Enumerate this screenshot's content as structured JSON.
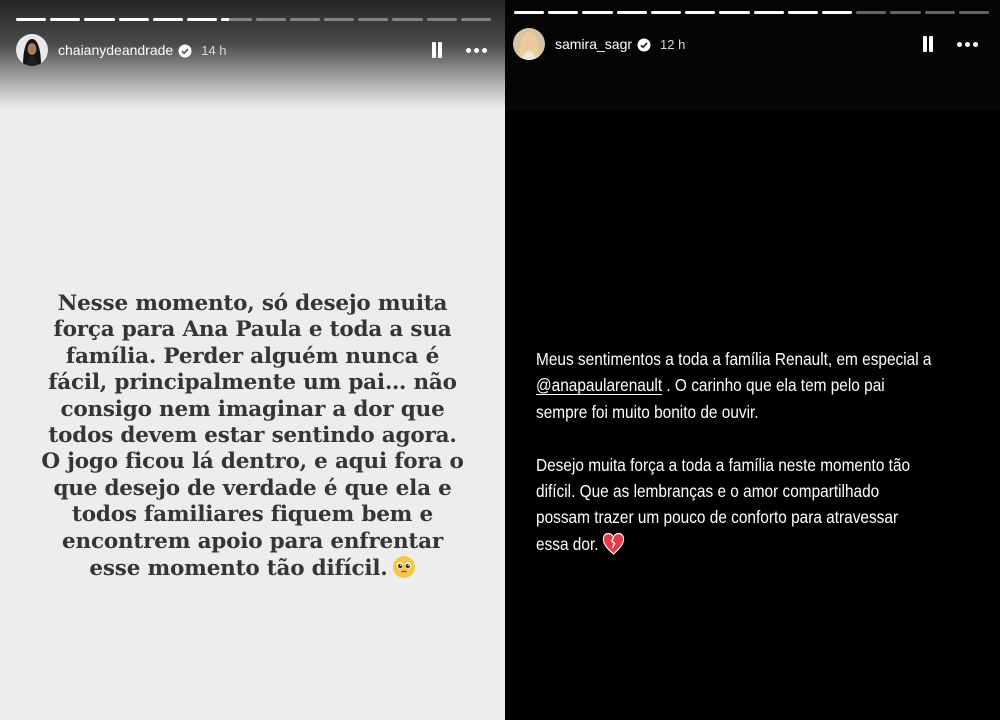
{
  "left": {
    "username": "chaianydeandrade",
    "time": "14 h",
    "lines": [
      "Nesse momento, só desejo muita",
      "força para Ana Paula e toda a sua",
      "família. Perder alguém nunca é",
      "fácil, principalmente um pai… não",
      "consigo nem imaginar a dor que",
      "todos devem estar sentindo agora.",
      "O jogo ficou lá dentro, e aqui fora o",
      "que desejo de verdade é que ela e",
      "todos familiares fiquem bem e",
      "encontrem apoio para enfrentar",
      "esse momento tão difícil."
    ]
  },
  "right": {
    "username": "samira_sagr",
    "time": "12 h",
    "line1": "Meus sentimentos a toda a família Renault, em especial a",
    "mention": "@anapaularenault",
    "line2_rest": " . O carinho que ela tem pelo pai",
    "line3": "sempre foi muito bonito de ouvir.",
    "line4": "Desejo muita força a toda a família neste momento tão",
    "line5": "difícil. Que as lembranças e o amor compartilhado",
    "line6": "possam trazer um pouco de conforto para atravessar",
    "line7": "essa dor."
  },
  "icons": {
    "verified": "verified-badge-icon",
    "pause": "pause-icon",
    "more": "more-options-icon",
    "emoji_left": "pleading-face-emoji",
    "emoji_right": "heart-emoji"
  },
  "colors": {
    "left_bg": "#ededed",
    "left_text": "#353535",
    "right_bg": "#000000",
    "right_text": "#ffffff"
  }
}
